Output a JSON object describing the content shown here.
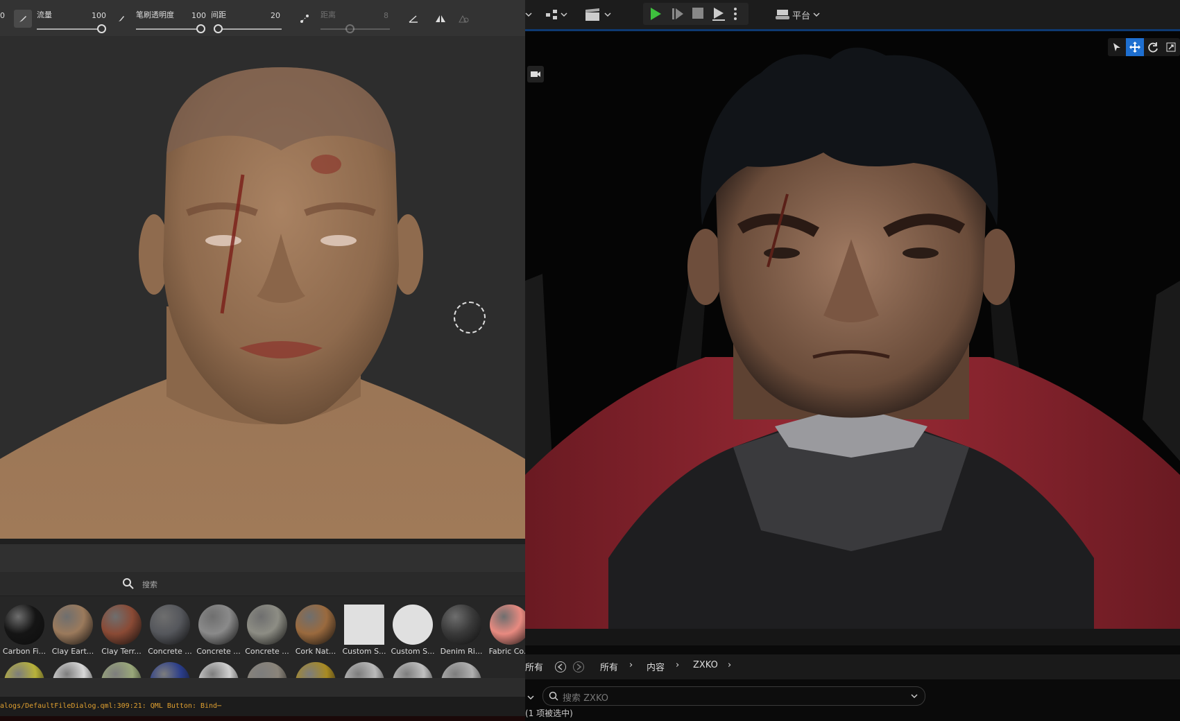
{
  "left_toolbar": {
    "leading_num": "0",
    "flow_label": "流量",
    "flow_value": "100",
    "brush_opacity_label": "笔刷透明度",
    "brush_opacity_value": "100",
    "spacing_label": "间距",
    "spacing_value": "20",
    "distance_label": "距离",
    "distance_value": "8"
  },
  "shelf": {
    "search_placeholder": "搜索",
    "materials": [
      {
        "label": "Carbon Fi...",
        "color": "#151515"
      },
      {
        "label": "Clay Eart...",
        "color": "#9b7a5c"
      },
      {
        "label": "Clay Terr...",
        "color": "#8a4a35"
      },
      {
        "label": "Concrete ...",
        "color": "#55575c"
      },
      {
        "label": "Concrete ...",
        "color": "#8a8a8a"
      },
      {
        "label": "Concrete ...",
        "color": "#8d8d84"
      },
      {
        "label": "Cork Nat...",
        "color": "#9a6a3e"
      },
      {
        "label": "Custom S...",
        "color": "#e0e0e0"
      },
      {
        "label": "Custom S...",
        "color": "#e0e0e0"
      },
      {
        "label": "Denim Ri...",
        "color": "#3a3a3a"
      },
      {
        "label": "Fabric Co...",
        "color": "#e88a80"
      }
    ],
    "row2_colors": [
      "#b8b23a",
      "#d8d8d8",
      "#9aa87a",
      "#2a3d8a",
      "#d0d0d0",
      "#8a847a",
      "#a88a22",
      "#bbbbbb",
      "#c0c0c0",
      "#b0b0b0"
    ]
  },
  "log": {
    "text": "alogs/DefaultFileDialog.qml:309:21: QML Button: Bind⋯"
  },
  "right_toolbar": {
    "platform_label": "平台"
  },
  "content_browser": {
    "left_label": "所有",
    "breadcrumb": [
      "所有",
      "内容",
      "ZXKO"
    ],
    "search_placeholder": "搜索 ZXKO",
    "status": "(1 项被选中)"
  },
  "colors": {
    "accent_blue": "#1e6fd0",
    "play_green": "#3ec13e",
    "log_orange": "#e0a030"
  }
}
